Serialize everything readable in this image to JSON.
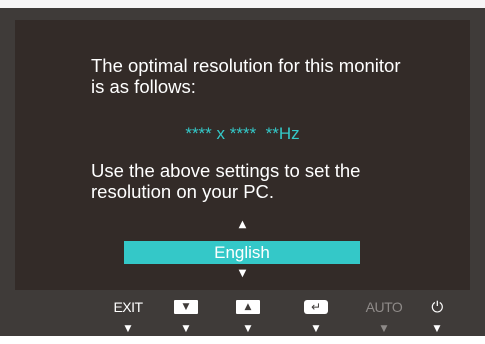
{
  "osd": {
    "message_top": "The optimal resolution for this monitor is as follows:",
    "resolution": "**** x ****  **Hz",
    "message_bottom": "Use the above settings to set the resolution on your PC.",
    "language_up_arrow": "▲",
    "language_selected": "English",
    "language_down_arrow": "▼"
  },
  "buttons": [
    {
      "label": "EXIT",
      "icon": "exit",
      "enabled": true
    },
    {
      "label": "▼",
      "icon": "down-arrow",
      "enabled": true
    },
    {
      "label": "▲",
      "icon": "up-arrow",
      "enabled": true
    },
    {
      "label": "↵",
      "icon": "enter",
      "enabled": true
    },
    {
      "label": "AUTO",
      "icon": "auto",
      "enabled": false
    },
    {
      "label": "⏻",
      "icon": "power",
      "enabled": true
    }
  ],
  "button_pointer": "▼",
  "colors": {
    "bezel": "#3f3b39",
    "screen": "#332b28",
    "accent": "#34c8c8",
    "text": "#ffffff",
    "dimmed": "#8e8a88"
  }
}
